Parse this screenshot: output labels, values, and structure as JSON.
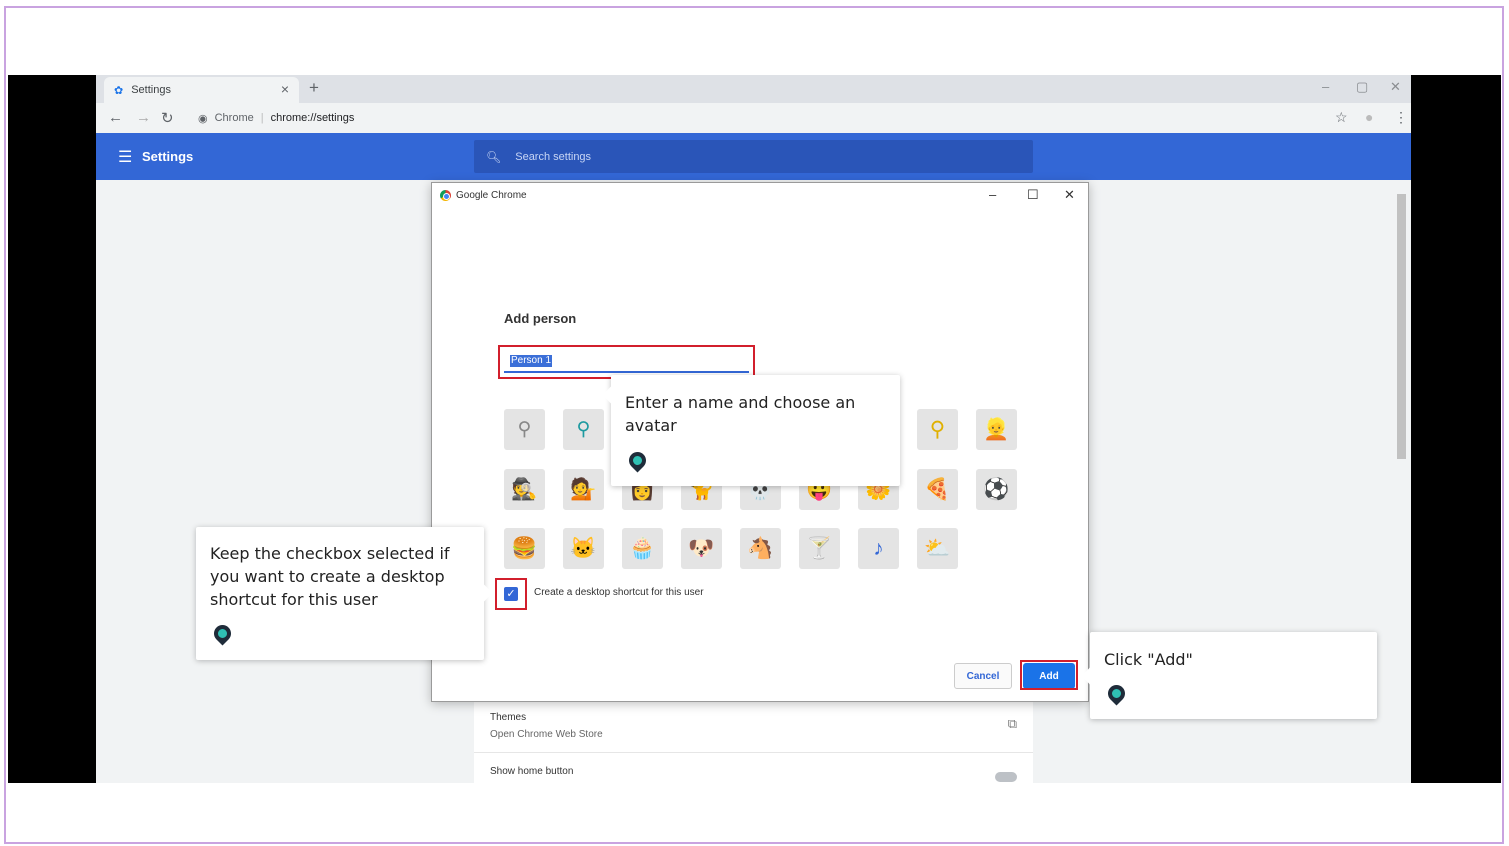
{
  "browser": {
    "tab_title": "Settings",
    "tab_close": "×",
    "new_tab": "+",
    "address_site": "Chrome",
    "address_url": "chrome://settings",
    "window_controls": [
      "–",
      "▢",
      "✕"
    ]
  },
  "settings": {
    "title": "Settings",
    "search_placeholder": "Search settings",
    "themes_title": "Themes",
    "themes_subtitle": "Open Chrome Web Store",
    "home_button_label": "Show home button"
  },
  "dialog": {
    "window_title": "Google Chrome",
    "heading": "Add person",
    "name_value": "Person 1",
    "checkbox_label": "Create a desktop shortcut for this user",
    "checkbox_checked": true,
    "cancel_label": "Cancel",
    "add_label": "Add",
    "avatars": [
      [
        "person-outline",
        "person-teal",
        "hidden",
        "hidden",
        "hidden",
        "hidden",
        "hidden",
        "person-yellow",
        "blonde"
      ],
      [
        "ninja",
        "spy",
        "hidden",
        "hidden",
        "hidden",
        "hidden",
        "hidden",
        "pizza",
        "soccer-ball"
      ],
      [
        "burger",
        "cat",
        "cupcake",
        "dog",
        "horse",
        "cocktail",
        "music-note",
        "sun-cloud"
      ]
    ]
  },
  "annotations": {
    "tip_name": "Enter a name and choose an avatar",
    "tip_checkbox": "Keep the checkbox selected if you want to create a desktop shortcut for this user",
    "tip_add": "Click \"Add\"",
    "highlight_color": "#d21f2c"
  }
}
